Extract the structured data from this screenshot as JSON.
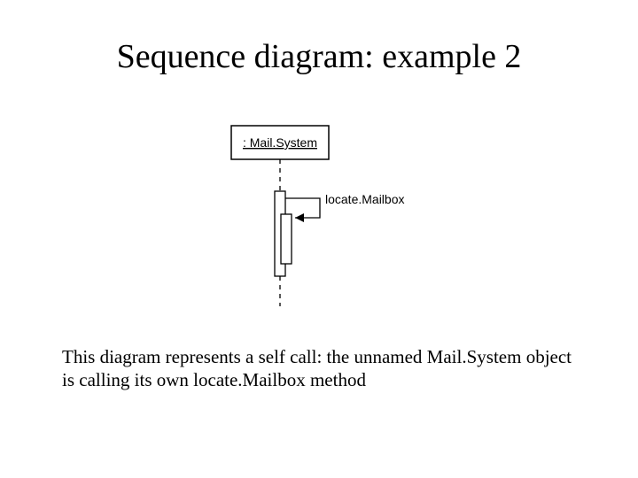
{
  "title": "Sequence diagram: example 2",
  "diagram": {
    "object_label": ": Mail.System",
    "message_label": "locate.Mailbox"
  },
  "caption": "This diagram represents a self call: the unnamed Mail.System object is calling its own locate.Mailbox method"
}
